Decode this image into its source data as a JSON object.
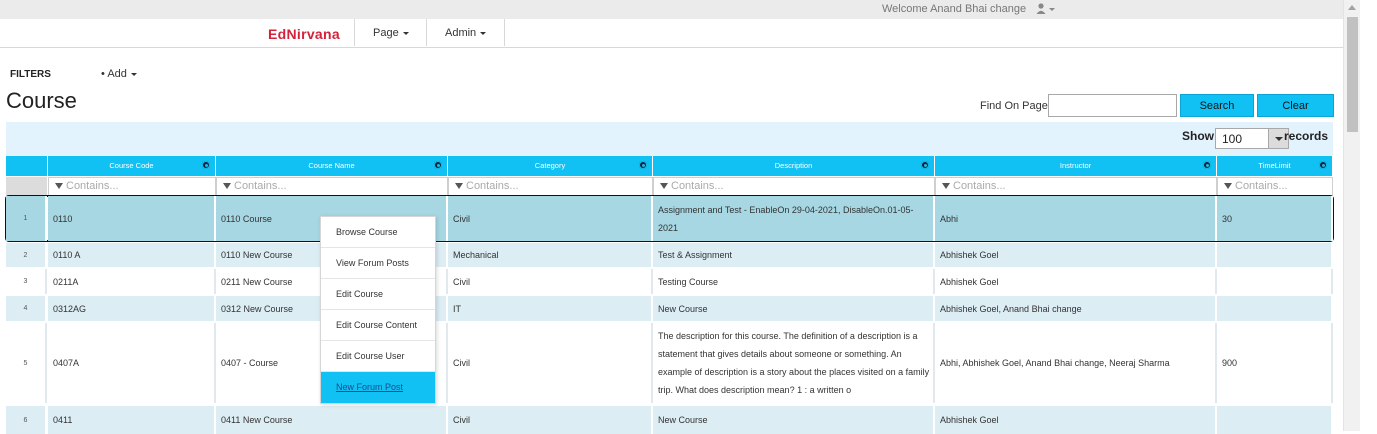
{
  "top_strip": {
    "welcome": "Welcome Anand Bhai change",
    "user_icon": "user-icon"
  },
  "navbar": {
    "brand": "EdNirvana",
    "items": [
      {
        "label": "Page"
      },
      {
        "label": "Admin"
      }
    ],
    "brand_color": "#d6213b"
  },
  "filters": {
    "label": "FILTERS",
    "add_label": "Add"
  },
  "page_title": "Course",
  "find": {
    "label": "Find On Page",
    "value": "",
    "search_label": "Search",
    "clear_label": "Clear"
  },
  "grid": {
    "show_label": "Show",
    "page_size": "100",
    "records_label": "records",
    "filter_placeholder": "Contains...",
    "columns": [
      "Course Code",
      "Course Name",
      "Category",
      "Description",
      "Instructor",
      "TimeLimit"
    ],
    "rows": [
      {
        "num": "1",
        "code": "0110",
        "name": "0110 Course",
        "category": "Civil",
        "description": "Assignment and Test - EnableOn 29-04-2021, DisableOn.01-05-2021",
        "instructor": "Abhi",
        "timelimit": "30"
      },
      {
        "num": "2",
        "code": "0110 A",
        "name": "0110 New Course",
        "category": "Mechanical",
        "description": "Test & Assignment",
        "instructor": "Abhishek Goel",
        "timelimit": ""
      },
      {
        "num": "3",
        "code": "0211A",
        "name": "0211 New Course",
        "category": "Civil",
        "description": "Testing Course",
        "instructor": "Abhishek Goel",
        "timelimit": ""
      },
      {
        "num": "4",
        "code": "0312AG",
        "name": "0312 New Course",
        "category": "IT",
        "description": "New Course",
        "instructor": "Abhishek Goel, Anand Bhai change",
        "timelimit": ""
      },
      {
        "num": "5",
        "code": "0407A",
        "name": "0407 - Course",
        "category": "Civil",
        "description": "The description for this course. The definition of a description is a statement that gives details about someone or something. An example of description is a story about the places visited on a family trip. What does description mean? 1 : a written o",
        "instructor": "Abhi, Abhishek Goel, Anand Bhai change, Neeraj Sharma",
        "timelimit": "900"
      },
      {
        "num": "6",
        "code": "0411",
        "name": "0411 New Course",
        "category": "Civil",
        "description": "New Course",
        "instructor": "Abhishek Goel",
        "timelimit": ""
      }
    ],
    "accent_color": "#12c1f4"
  },
  "context_menu": {
    "items": [
      {
        "label": "Browse Course"
      },
      {
        "label": "View Forum Posts"
      },
      {
        "label": "Edit Course"
      },
      {
        "label": "Edit Course Content"
      },
      {
        "label": "Edit Course User"
      },
      {
        "label": "New Forum Post"
      }
    ]
  }
}
